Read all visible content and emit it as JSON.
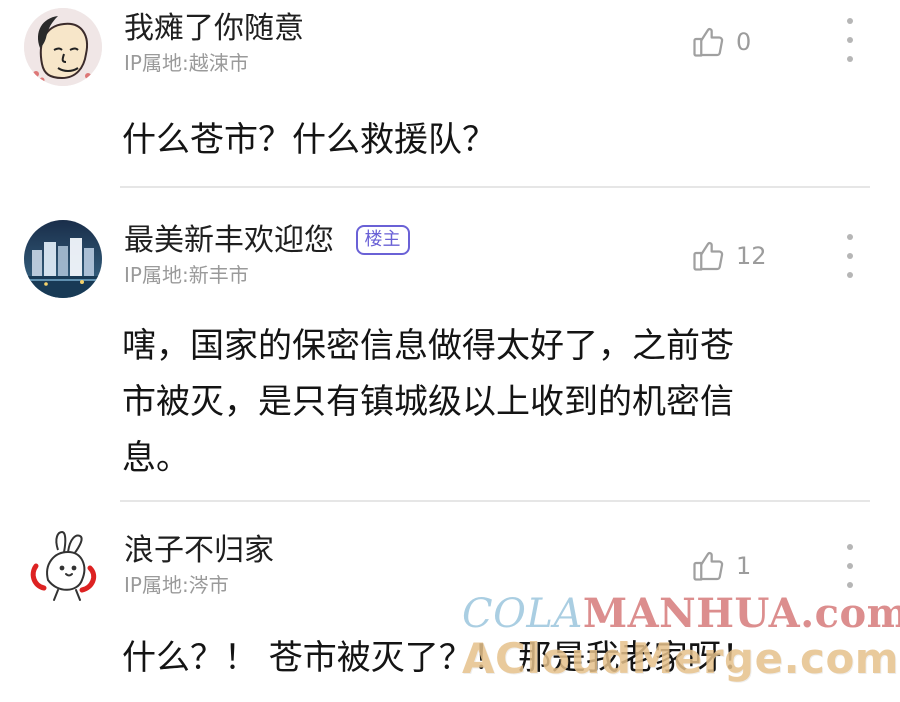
{
  "comments": [
    {
      "username": "我瘫了你随意",
      "ip": "IP属地:越涑市",
      "likes": "0",
      "badge": "",
      "content": "什么苍市？什么救援队？",
      "avatar_icon": "face-avatar-icon"
    },
    {
      "username": "最美新丰欢迎您",
      "ip": "IP属地:新丰市",
      "likes": "12",
      "badge": "楼主",
      "content": "嗐，国家的保密信息做得太好了，之前苍\n市被灭，是只有镇城级以上收到的机密信\n息。",
      "avatar_icon": "city-avatar-icon"
    },
    {
      "username": "浪子不归家",
      "ip": "IP属地:涔市",
      "likes": "1",
      "badge": "",
      "content": "什么？！ 苍市被灭了？！ 那是我老家呀！",
      "avatar_icon": "rabbit-avatar-icon"
    }
  ],
  "icons": {
    "like": "thumbs-up-icon",
    "more": "more-vertical-icon"
  },
  "watermark": {
    "line1_a": "COLA",
    "line1_b": "MANHUA",
    "line1_c": ".com",
    "line2": "ACloudMerge.com"
  }
}
